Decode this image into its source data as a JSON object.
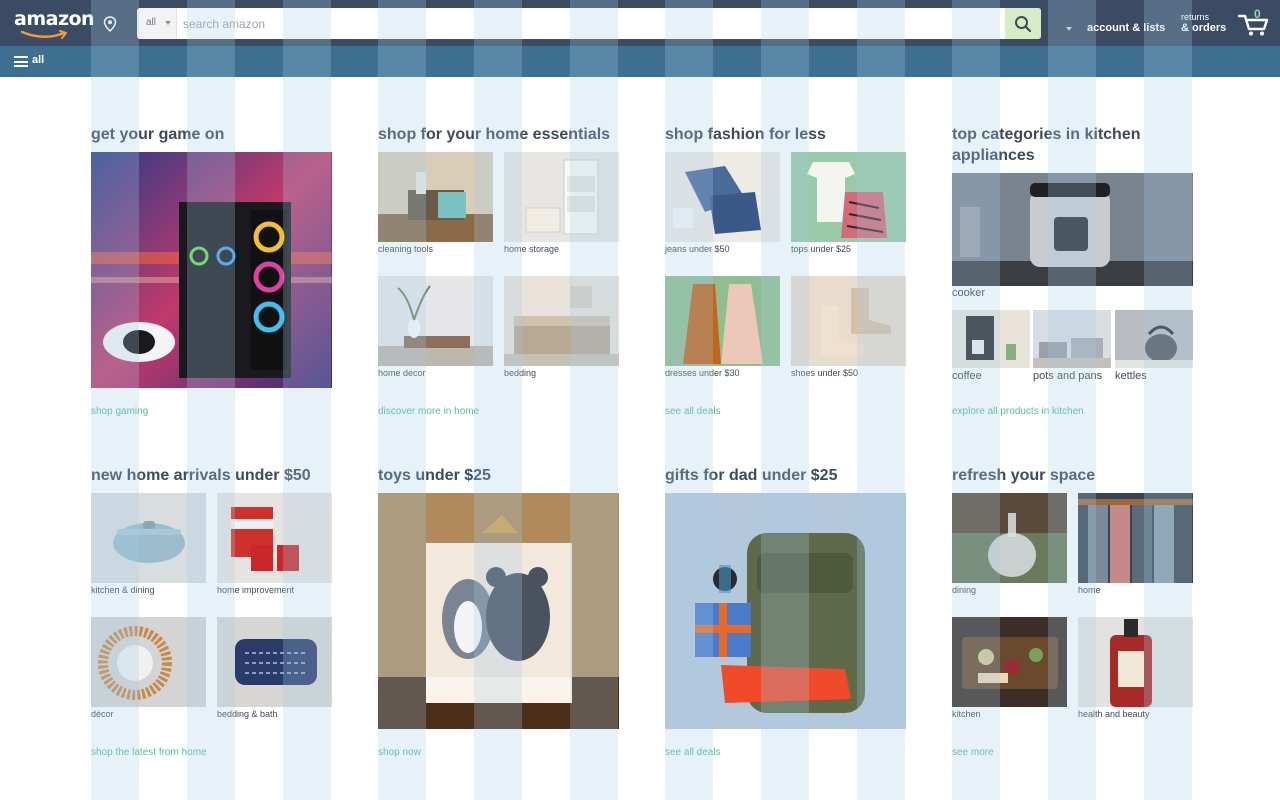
{
  "header": {
    "logo_text": "amazon",
    "search": {
      "category": "all",
      "placeholder": "search amazon"
    },
    "account_label": "account & lists",
    "returns_top": "returns",
    "returns_bottom": "& orders",
    "cart_count": "0",
    "nav_all": "all"
  },
  "cards": [
    {
      "title": "get your game on",
      "link": "shop gaming",
      "image": "gaming-pc-and-controller"
    },
    {
      "title": "shop for your home essentials",
      "link": "discover more in home",
      "tiles": [
        {
          "label": "cleaning tools",
          "image": "cleaning-basket"
        },
        {
          "label": "home storage",
          "image": "storage-drawers"
        },
        {
          "label": "home decor",
          "image": "vase-decor"
        },
        {
          "label": "bedding",
          "image": "bed"
        }
      ]
    },
    {
      "title": "shop fashion for less",
      "link": "see all deals",
      "tiles": [
        {
          "label": "jeans under $50",
          "image": "jeans"
        },
        {
          "label": "tops under $25",
          "image": "tops"
        },
        {
          "label": "dresses under $30",
          "image": "dresses"
        },
        {
          "label": "shoes under $50",
          "image": "boots"
        }
      ]
    },
    {
      "title": "top categories in kitchen appliances",
      "link": "explore all products in kitchen",
      "main_label": "cooker",
      "tiles": [
        {
          "label": "coffee",
          "image": "coffee-maker"
        },
        {
          "label": "pots and pans",
          "image": "pots"
        },
        {
          "label": "kettles",
          "image": "kettle"
        }
      ]
    },
    {
      "title": "new home arrivals under $50",
      "link": "shop the latest from home",
      "tiles": [
        {
          "label": "kitchen & dining",
          "image": "dutch-oven"
        },
        {
          "label": "home improvement",
          "image": "paint-cans"
        },
        {
          "label": "décor",
          "image": "sun-mirror"
        },
        {
          "label": "bedding & bath",
          "image": "pillow"
        }
      ]
    },
    {
      "title": "toys under $25",
      "link": "shop now",
      "image": "plush-toys-in-box"
    },
    {
      "title": "gifts for dad under $25",
      "link": "see all deals",
      "image": "backpack-gifts"
    },
    {
      "title": "refresh your space",
      "link": "see more",
      "tiles": [
        {
          "label": "dining",
          "image": "glass-decanter"
        },
        {
          "label": "home",
          "image": "towels"
        },
        {
          "label": "kitchen",
          "image": "charcuterie"
        },
        {
          "label": "health and beauty",
          "image": "soap-bottle"
        }
      ]
    }
  ],
  "colors": {
    "header_bg": "#3b4b63",
    "nav_bg": "#3d7090",
    "link": "#4fbf98",
    "search_button": "#d7ecc4",
    "cart_count": "#8fd6b4"
  },
  "icons": [
    "location-pin-icon",
    "caret-down-icon",
    "search-icon",
    "cart-icon",
    "hamburger-icon"
  ]
}
